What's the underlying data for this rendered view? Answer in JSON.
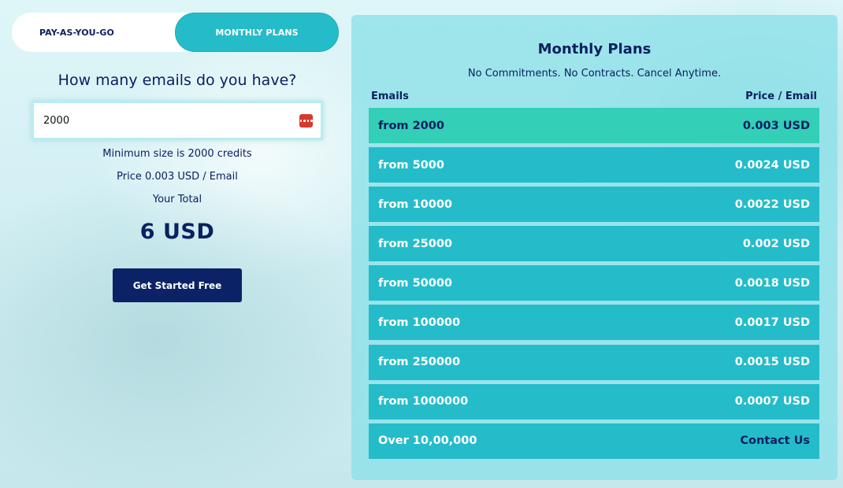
{
  "toggle": {
    "payg_label": "PAY-AS-YOU-GO",
    "monthly_label": "MONTHLY PLANS",
    "active": "monthly"
  },
  "calculator": {
    "question": "How many emails do you have?",
    "input_value": "2000",
    "min_text": "Minimum size is 2000 credits",
    "price_text": "Price 0.003 USD / Email",
    "total_label": "Your Total",
    "total_amount": "6 USD",
    "cta_label": "Get Started Free"
  },
  "plans": {
    "title": "Monthly Plans",
    "subtitle": "No Commitments. No Contracts. Cancel Anytime.",
    "col_emails": "Emails",
    "col_price": "Price / Email",
    "rows": [
      {
        "tier": "from 2000",
        "price": "0.003 USD",
        "active": true
      },
      {
        "tier": "from 5000",
        "price": "0.0024 USD"
      },
      {
        "tier": "from 10000",
        "price": "0.0022 USD"
      },
      {
        "tier": "from 25000",
        "price": "0.002 USD"
      },
      {
        "tier": "from 50000",
        "price": "0.0018 USD"
      },
      {
        "tier": "from 100000",
        "price": "0.0017 USD"
      },
      {
        "tier": "from 250000",
        "price": "0.0015 USD"
      },
      {
        "tier": "from 1000000",
        "price": "0.0007 USD"
      },
      {
        "tier": "Over 10,00,000",
        "price": "Contact Us"
      }
    ]
  },
  "colors": {
    "navy": "#0b2060",
    "teal": "#25bcca",
    "active_row": "#33cfb7",
    "cta_bg": "#0b2366",
    "input_icon": "#d63a2f"
  },
  "icons": {
    "input_icon": "password-manager-icon"
  }
}
